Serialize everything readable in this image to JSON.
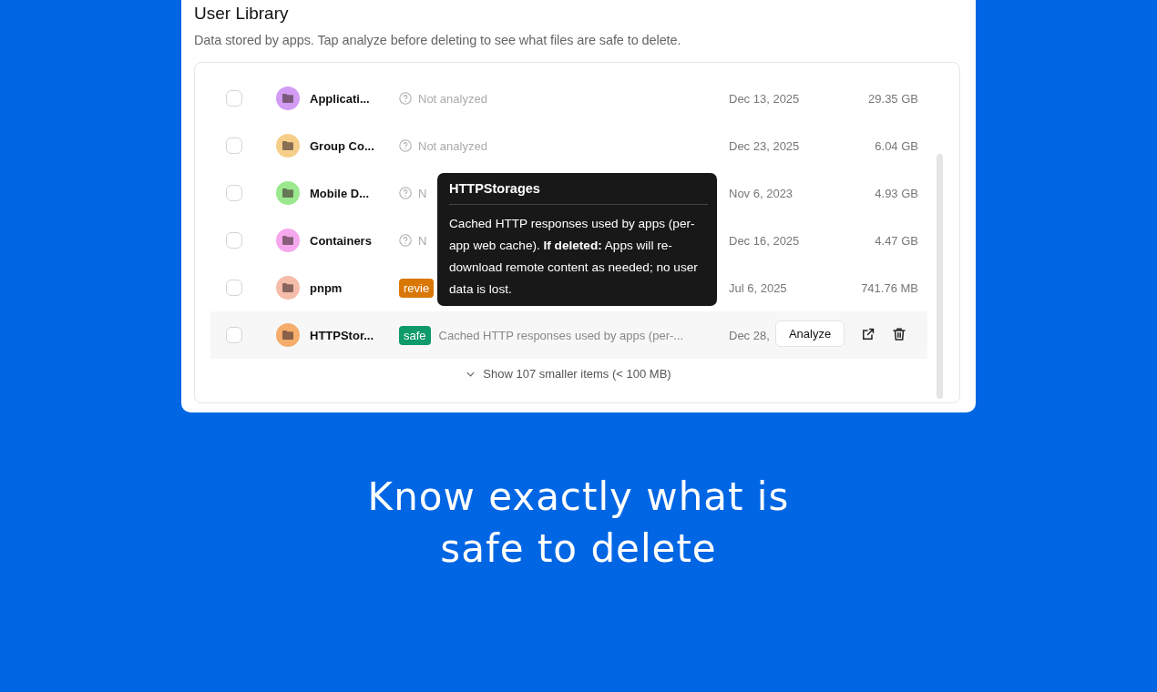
{
  "panel": {
    "title": "User Library",
    "subtitle": "Data stored by apps. Tap analyze before deleting to see what files are safe to delete."
  },
  "rows": [
    {
      "name": "Applicati...",
      "color": "#d29cf5",
      "status": {
        "kind": "pending",
        "text": "Not analyzed"
      },
      "date": "Dec 13, 2025",
      "size": "29.35 GB",
      "checked": false
    },
    {
      "name": "Group Co...",
      "color": "#f5cf8a",
      "status": {
        "kind": "pending",
        "text": "Not analyzed"
      },
      "date": "Dec 23, 2025",
      "size": "6.04 GB",
      "checked": false
    },
    {
      "name": "Mobile D...",
      "color": "#9be88f",
      "status": {
        "kind": "pending",
        "text": "N"
      },
      "date": "Nov 6, 2023",
      "size": "4.93 GB",
      "checked": false
    },
    {
      "name": "Containers",
      "color": "#f5a8ee",
      "status": {
        "kind": "pending",
        "text": "N"
      },
      "date": "Dec 16, 2025",
      "size": "4.47 GB",
      "checked": false
    },
    {
      "name": "pnpm",
      "color": "#f4bca9",
      "status": {
        "kind": "badge",
        "text": "revie",
        "color": "#d97706"
      },
      "date": "Jul 6, 2025",
      "size": "741.76 MB",
      "checked": false
    },
    {
      "name": "HTTPStor...",
      "color": "#f5ad6c",
      "status": {
        "kind": "badge",
        "text": "safe",
        "color": "#0f9a6a",
        "note": "Cached HTTP responses used by apps (per-..."
      },
      "date": "Dec 28,",
      "checked": false,
      "actions": {
        "analyze": "Analyze"
      }
    }
  ],
  "more": "Show 107 smaller items (< 100 MB)",
  "tooltip": {
    "title": "HTTPStorages",
    "body": "Cached HTTP responses used by apps (per-app web cache). **If deleted:** Apps will re-download remote content as needed; no user data is lost."
  },
  "headline": [
    "Know exactly what is",
    "safe to delete"
  ]
}
